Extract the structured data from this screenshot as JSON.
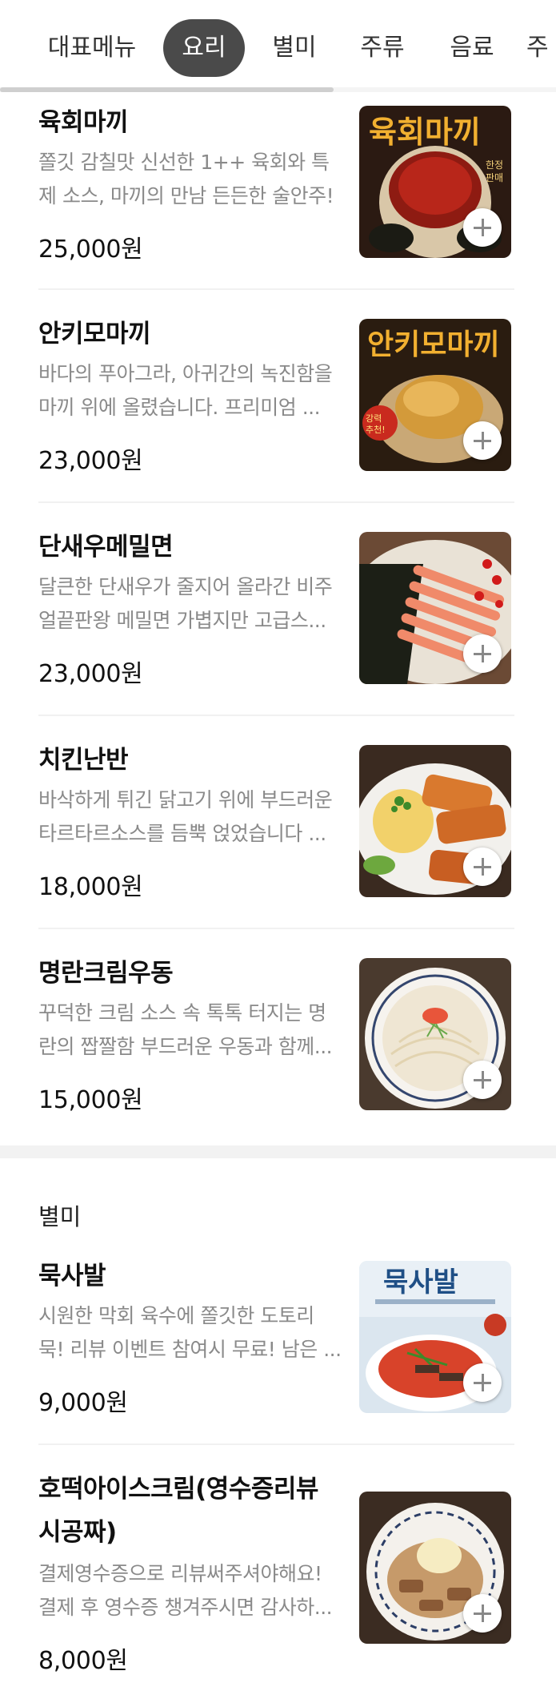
{
  "tabs": [
    {
      "label": "대표메뉴",
      "active": false
    },
    {
      "label": "요리",
      "active": true
    },
    {
      "label": "별미",
      "active": false
    },
    {
      "label": "주류",
      "active": false
    },
    {
      "label": "음료",
      "active": false
    },
    {
      "label": "주",
      "active": false
    }
  ],
  "tab_scroll_progress": 0.6,
  "colors": {
    "active_tab_bg": "#4a4a4a",
    "desc_text": "#8a8a8a",
    "section_gap": "#f2f2f2"
  },
  "sections": [
    {
      "title": "",
      "items": [
        {
          "name": "육회마끼",
          "desc": "쫄깃 감칠맛 신선한 1++ 육회와 특제 소스, 마끼의 만남 든든한 술안주!",
          "desc_lines": [
            "쫄깃 감칠맛 신선한 1++ 육회와 특",
            "제 소스, 마끼의 만남 든든한 술안주!"
          ],
          "price": "25,000원",
          "image_text": "육회마끼",
          "image_badge": "한정판매"
        },
        {
          "name": "안키모마끼",
          "desc_lines": [
            "바다의 푸아그라, 아귀간의 녹진함을",
            "마끼 위에 올렸습니다. 프리미엄 ..."
          ],
          "price": "23,000원",
          "image_text": "안키모마끼",
          "image_badge": "강력추천!"
        },
        {
          "name": "단새우메밀면",
          "desc_lines": [
            "달큰한 단새우가 줄지어 올라간 비주",
            "얼끝판왕 메밀면 가볍지만 고급스..."
          ],
          "price": "23,000원"
        },
        {
          "name": "치킨난반",
          "desc_lines": [
            "바삭하게 튀긴 닭고기 위에 부드러운",
            "타르타르소스를 듬뿍 얹었습니다 ..."
          ],
          "price": "18,000원"
        },
        {
          "name": "명란크림우동",
          "desc_lines": [
            "꾸덕한 크림 소스 속 톡톡 터지는 명",
            "란의 짭짤함 부드러운 우동과 함께..."
          ],
          "price": "15,000원"
        }
      ]
    },
    {
      "title": "별미",
      "items": [
        {
          "name": "묵사발",
          "desc_lines": [
            "시원한 막회 육수에 쫄깃한 도토리",
            "묵! 리뷰 이벤트 참여시 무료! 남은 ..."
          ],
          "price": "9,000원",
          "image_text": "묵사발"
        },
        {
          "name_lines": [
            "호떡아이스크림(영수증리뷰",
            "시공짜)"
          ],
          "desc_lines": [
            "결제영수증으로 리뷰써주셔야해요!",
            "결제 후 영수증 챙겨주시면 감사하..."
          ],
          "price": "8,000원"
        }
      ]
    }
  ]
}
